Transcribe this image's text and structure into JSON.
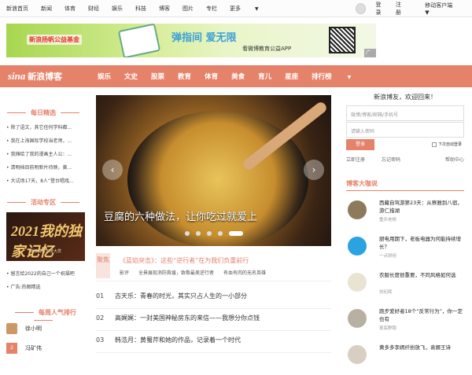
{
  "topbar": {
    "nav": [
      "新浪首页",
      "新闻",
      "体育",
      "财经",
      "娱乐",
      "科技",
      "博客",
      "图片",
      "专栏",
      "更多"
    ],
    "login": "登录",
    "register": "注册",
    "mobile": "移动客户端"
  },
  "banner": {
    "logo": "新浪扬帆公益基金",
    "title": "弹指间 爱无限",
    "subtitle": "看微博教育公益APP",
    "ad": "广告"
  },
  "header": {
    "logo_mark": "sina",
    "logo_text": "新浪博客",
    "nav": [
      "娱乐",
      "文史",
      "股票",
      "教育",
      "体育",
      "美食",
      "育儿",
      "星座",
      "排行榜"
    ]
  },
  "left": {
    "daily_title": "每日精选",
    "daily": [
      "• 除了语文，其它任何学科都...",
      "• 我在上海国际学校当老师，...",
      "• 我摊给了我的漫画主人公：...",
      "• 清明档目前明新片待映，黄...",
      "• 大试场17天，8人“登台唱戏..."
    ],
    "activity_title": "活动专区",
    "promo_title": "2021我的独家记忆",
    "promo_sub": "新浪博客年度大赏",
    "activity": [
      "• 留言给2022的自己一个祝福吧",
      "• 广告:热图精选"
    ],
    "rank_title": "每周人气排行",
    "rank": [
      {
        "badge": "",
        "name": "徐小明"
      },
      {
        "badge": "2",
        "name": "冯矿伟"
      }
    ]
  },
  "carousel": {
    "caption": "豆腐的六种做法，让你吃过就爱上",
    "prev": "‹",
    "next": "›"
  },
  "feature": {
    "tag": "聚焦",
    "headline": "《蓝焰突击》：这些“逆行者”在为我们负重前行",
    "subs": [
      "影评",
      "全景展现消防救援，致敬最美逆行者",
      "有血有肉的无名英雄"
    ]
  },
  "news": [
    {
      "no": "01",
      "title": "古天乐：青春的时光，其实只占人生的一小部分"
    },
    {
      "no": "02",
      "title": "高娓娓：一封美国神秘房东的来信——我想分你点钱"
    },
    {
      "no": "03",
      "title": "韩浩月：黄蜀芹和她的作品，记录着一个时代"
    }
  ],
  "login": {
    "welcome": "新浪博友，欢迎回来！",
    "user_placeholder": "微博/博客/邮箱/手机号",
    "pass_placeholder": "请输入密码",
    "button": "登录",
    "auto": "下次自动登录",
    "register": "立即注册",
    "forgot": "忘记密码",
    "help": "帮助中心"
  },
  "right": {
    "title": "博客大咖说",
    "items": [
      {
        "title": "西藏自驾游第23天：从察雅到八宿，游仁措湖",
        "author": "重庆老帆"
      },
      {
        "title": "厨电用期下，老板电器为何能持续增长？",
        "author": "一点财经"
      },
      {
        "title": "衣服长度很重要，不同风格如何选",
        "author": "刘纪辉"
      },
      {
        "title": "跑步爱好者18个“反常行为”，你一定也有",
        "author": "夜底野跑"
      },
      {
        "title": "黄多多李嫣纤扮放飞，袁娜王诗",
        "author": ""
      }
    ]
  }
}
